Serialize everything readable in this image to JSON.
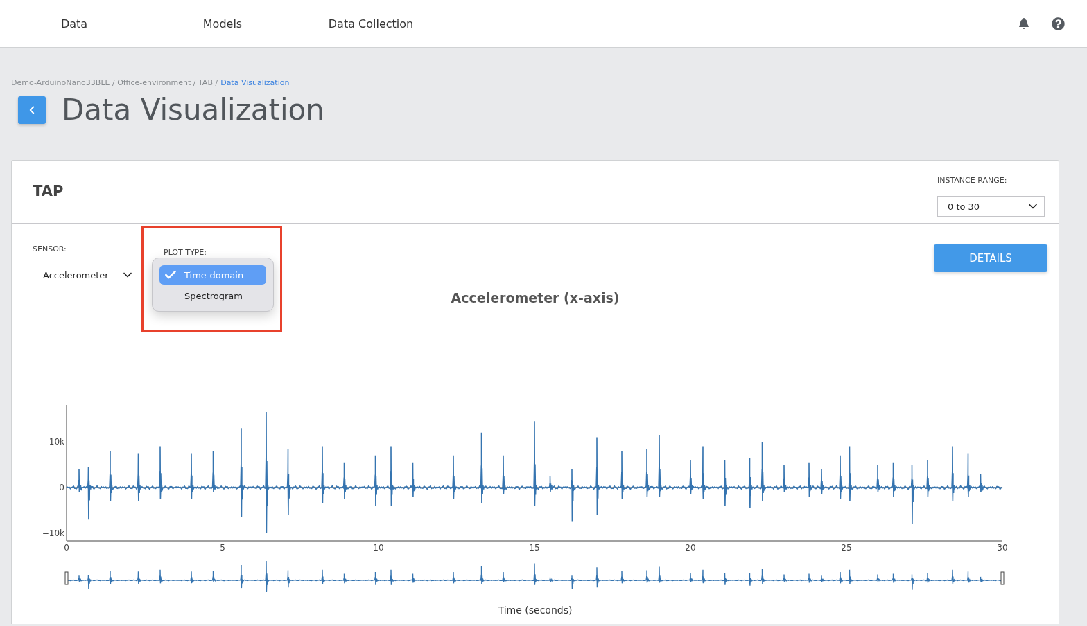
{
  "nav": {
    "items": [
      "Data",
      "Models",
      "Data Collection"
    ]
  },
  "breadcrumb": {
    "trail": "Demo-ArduinoNano33BLE / Office-environment / TAB /",
    "current": "Data Visualization"
  },
  "page_title": "Data Visualization",
  "card": {
    "title": "TAP",
    "instance_range": {
      "label": "INSTANCE RANGE:",
      "value": "0 to 30"
    },
    "sensor": {
      "label": "SENSOR:",
      "value": "Accelerometer"
    },
    "plot_type": {
      "label": "PLOT TYPE:",
      "options": [
        {
          "label": "Time-domain",
          "selected": true
        },
        {
          "label": "Spectrogram",
          "selected": false
        }
      ]
    },
    "details_button": "DETAILS",
    "chart": {
      "title": "Accelerometer (x-axis)",
      "y_ticks": [
        "10k",
        "0",
        "−10k"
      ],
      "x_ticks": [
        "0",
        "5",
        "10",
        "15",
        "20",
        "25",
        "30"
      ],
      "x_title": "Time (seconds)"
    }
  }
}
